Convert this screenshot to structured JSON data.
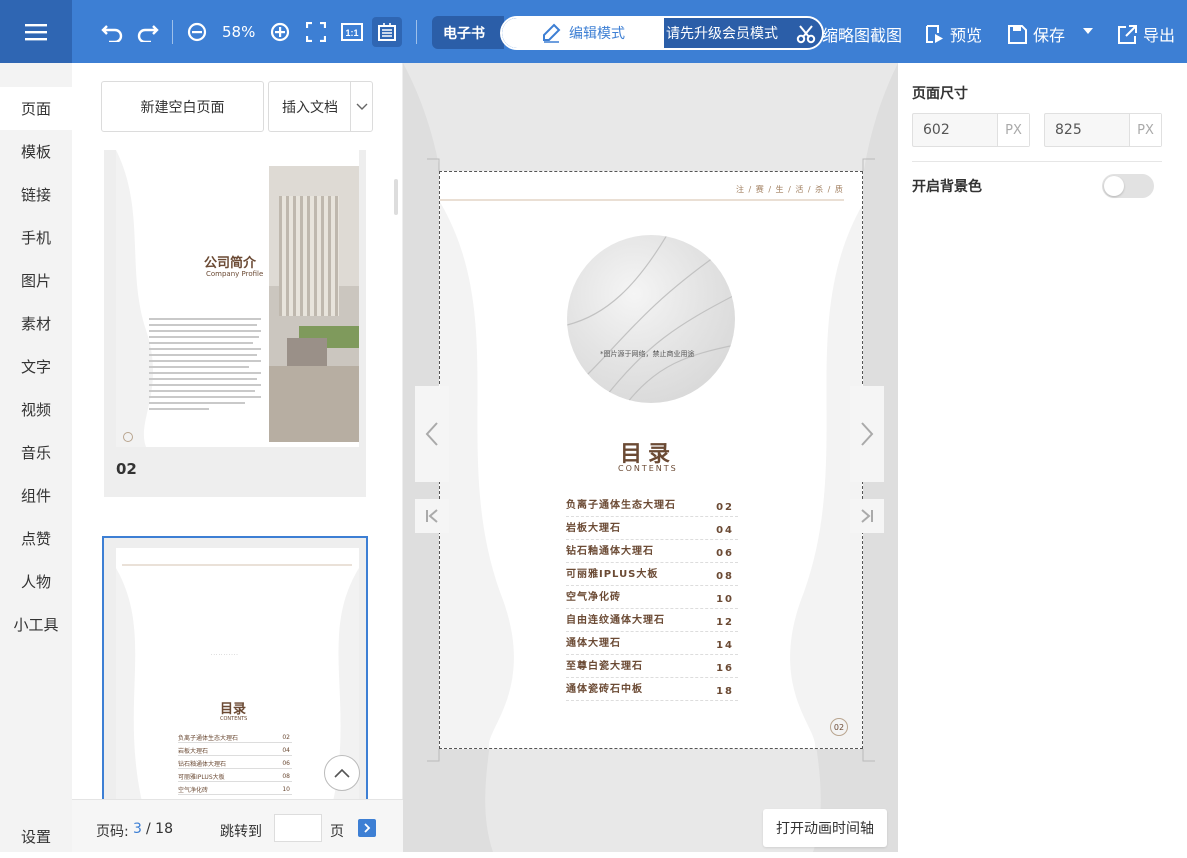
{
  "toolbar": {
    "zoom": "58%",
    "ebook_label": "电子书",
    "mode_edit_label": "编辑模式",
    "mode_group_label": "请先升级会员模式",
    "thumb_label": "缩略图截图",
    "preview_label": "预览",
    "save_label": "保存",
    "export_label": "导出"
  },
  "sidebar": {
    "items": [
      "页面",
      "模板",
      "链接",
      "手机",
      "图片",
      "素材",
      "文字",
      "视频",
      "音乐",
      "组件",
      "点赞",
      "人物",
      "小工具"
    ],
    "settings": "设置"
  },
  "panel": {
    "new_page": "新建空白页面",
    "insert_doc": "插入文档",
    "thumb1_num": "02",
    "thumb1_title": "公司简介",
    "thumb1_subtitle": "Company Profile"
  },
  "pager": {
    "label": "页码:",
    "current": "3",
    "total": "/ 18",
    "jump": "跳转到",
    "page_unit": "页",
    "input_value": ""
  },
  "page": {
    "header": "注 / 赛 / 生 / 活 / 杀 / 质",
    "caption": "*图片源于网络，禁止商业用途",
    "toc_title": "目录",
    "toc_sub": "CONTENTS",
    "page_num": "02",
    "toc": [
      {
        "t": "负离子通体生态大理石",
        "n": "02"
      },
      {
        "t": "岩板大理石",
        "n": "04"
      },
      {
        "t": "钻石釉通体大理石",
        "n": "06"
      },
      {
        "t": "可丽雅IPLUS大板",
        "n": "08"
      },
      {
        "t": "空气净化砖",
        "n": "10"
      },
      {
        "t": "自由连纹通体大理石",
        "n": "12"
      },
      {
        "t": "通体大理石",
        "n": "14"
      },
      {
        "t": "至尊白瓷大理石",
        "n": "16"
      },
      {
        "t": "通体瓷砖石中板",
        "n": "18"
      }
    ]
  },
  "canvas": {
    "timeline_btn": "打开动画时间轴"
  },
  "right": {
    "page_size": "页面尺寸",
    "width": "602",
    "height": "825",
    "unit": "PX",
    "bg_label": "开启背景色"
  },
  "colors": {
    "brand": "#3d7fd4",
    "brand_dark": "#2b5ea8",
    "accent_brown": "#6b4a34"
  }
}
